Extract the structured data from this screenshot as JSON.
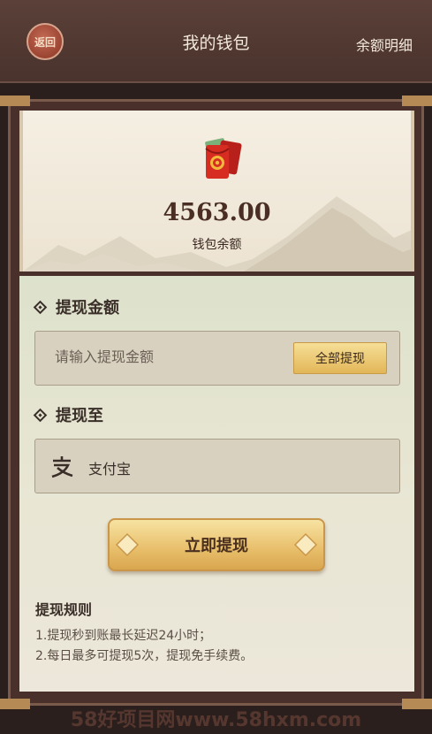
{
  "header": {
    "back_label": "返回",
    "title": "我的钱包",
    "detail_link": "余额明细"
  },
  "balance": {
    "amount": "4563.00",
    "label": "钱包余额"
  },
  "withdraw": {
    "amount_section_title": "提现金额",
    "amount_placeholder": "请输入提现金额",
    "withdraw_all_label": "全部提现",
    "destination_section_title": "提现至",
    "destination_label": "支付宝",
    "submit_label": "立即提现"
  },
  "rules": {
    "title": "提现规则",
    "items": [
      "1.提现秒到账最长延迟24小时；",
      "2.每日最多可提现5次，提现免手续费。"
    ]
  },
  "watermark": "58好项目网www.58hxm.com",
  "colors": {
    "header_bg": "#4a332d",
    "gold_button": "#e8be6a",
    "panel_bg": "#e9e6d4"
  }
}
